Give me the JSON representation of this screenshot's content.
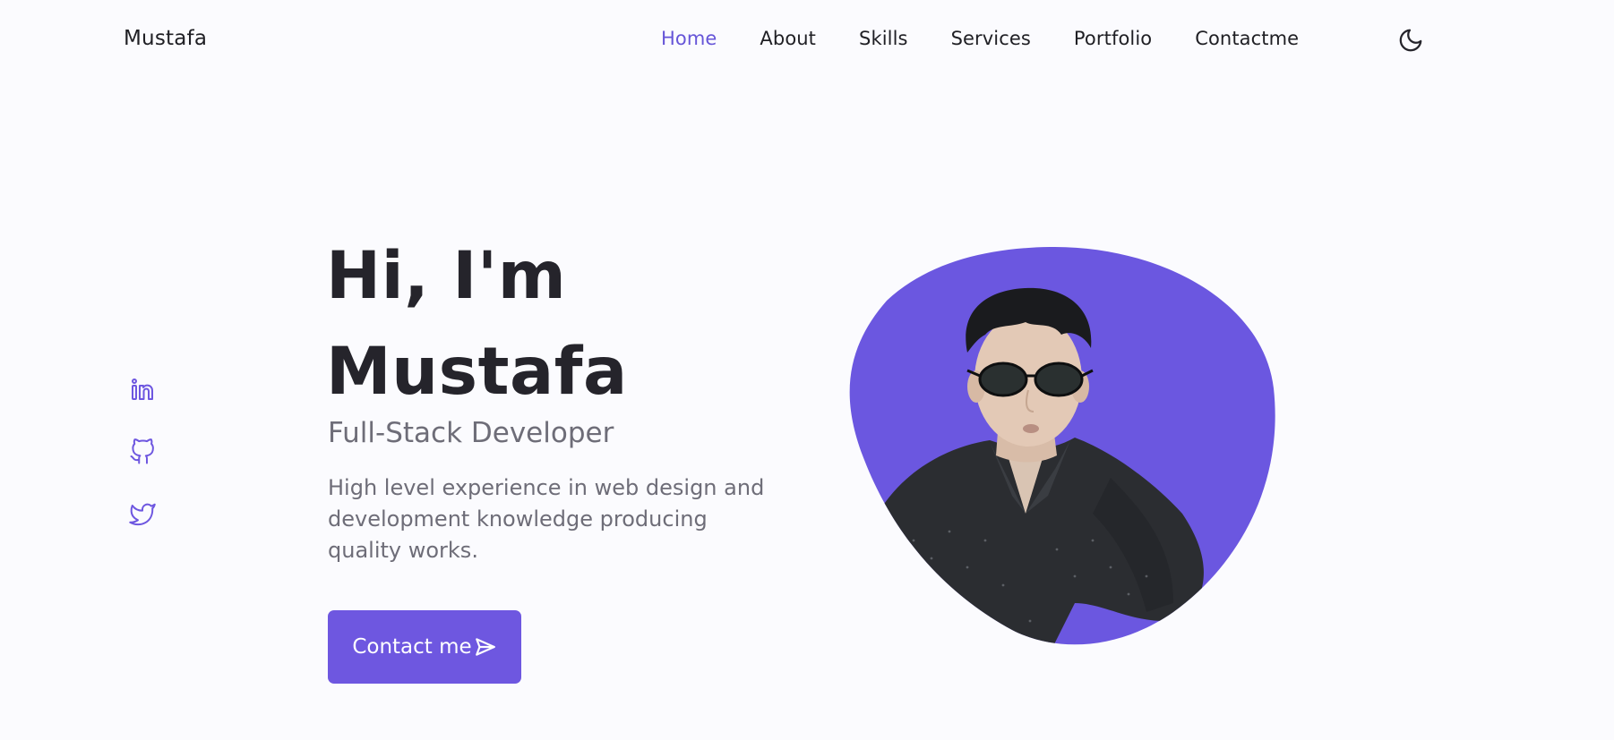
{
  "header": {
    "logo": "Mustafa",
    "nav": [
      {
        "label": "Home",
        "active": true
      },
      {
        "label": "About",
        "active": false
      },
      {
        "label": "Skills",
        "active": false
      },
      {
        "label": "Services",
        "active": false
      },
      {
        "label": "Portfolio",
        "active": false
      },
      {
        "label": "Contactme",
        "active": false
      }
    ],
    "theme_icon": "moon-icon"
  },
  "social": [
    {
      "icon": "linkedin-icon"
    },
    {
      "icon": "github-icon"
    },
    {
      "icon": "twitter-icon"
    }
  ],
  "hero": {
    "title_line1": "Hi, I'm",
    "title_line2": "Mustafa",
    "subtitle": "Full-Stack Developer",
    "description": "High level experience in web design and development knowledge producing quality works.",
    "button_label": "Contact me",
    "button_icon": "send-icon"
  },
  "colors": {
    "accent": "#6e57e0",
    "active_nav": "#6655d8",
    "background": "#fbfbfe",
    "text": "#1f1f24",
    "muted": "#6e6d78"
  }
}
